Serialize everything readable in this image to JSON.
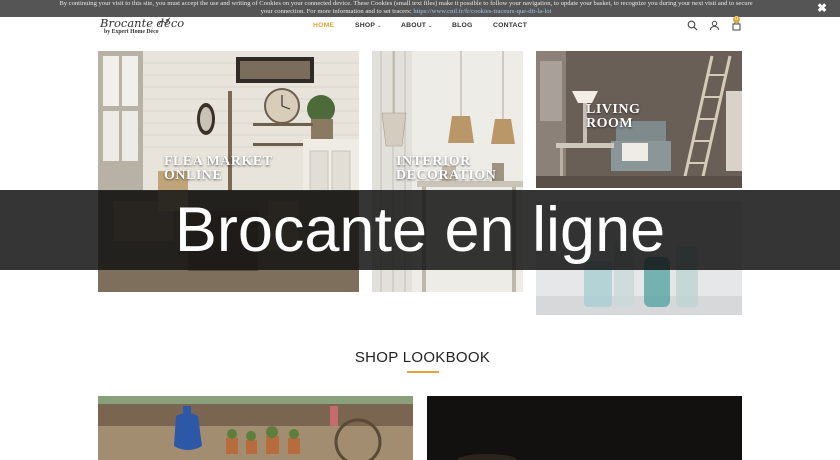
{
  "cookie_bar": {
    "text_line1": "By continuing your visit to this site, you must accept the use and writing of Cookies on your connected device. These Cookies (small text files) make it possible to follow your navigation, to update your basket, to recognize you during your next visit and to secure",
    "text_line2_prefix": "your connection. For more information and to set tracers:",
    "link_text": "https://www.cnil.fr/fr/cookies-traceurs-que-dit-la-loi",
    "close_symbol": "✖"
  },
  "header": {
    "logo_main": "Brocante déco",
    "logo_sub": "by Expert Home Déco",
    "nav": [
      {
        "label": "HOME",
        "active": true
      },
      {
        "label": "SHOP",
        "caret": "⌄"
      },
      {
        "label": "ABOUT",
        "caret": "⌄"
      },
      {
        "label": "BLOG"
      },
      {
        "label": "CONTACT"
      }
    ],
    "cart_count": "0",
    "icons": [
      "search-icon",
      "user-icon",
      "cart-icon"
    ]
  },
  "tiles": {
    "flea_market": {
      "line1": "FLEA MARKET",
      "line2": "ONLINE"
    },
    "interior": {
      "line1": "INTERIOR",
      "line2": "DECORATION"
    },
    "living": {
      "line1": "LIVING",
      "line2": "ROOM"
    }
  },
  "banner": {
    "title": "Brocante en ligne"
  },
  "lookbook": {
    "title": "SHOP LOOKBOOK"
  },
  "colors": {
    "accent": "#e0a63a",
    "cookie_bg": "#555555",
    "banner_bg": "#141414"
  }
}
